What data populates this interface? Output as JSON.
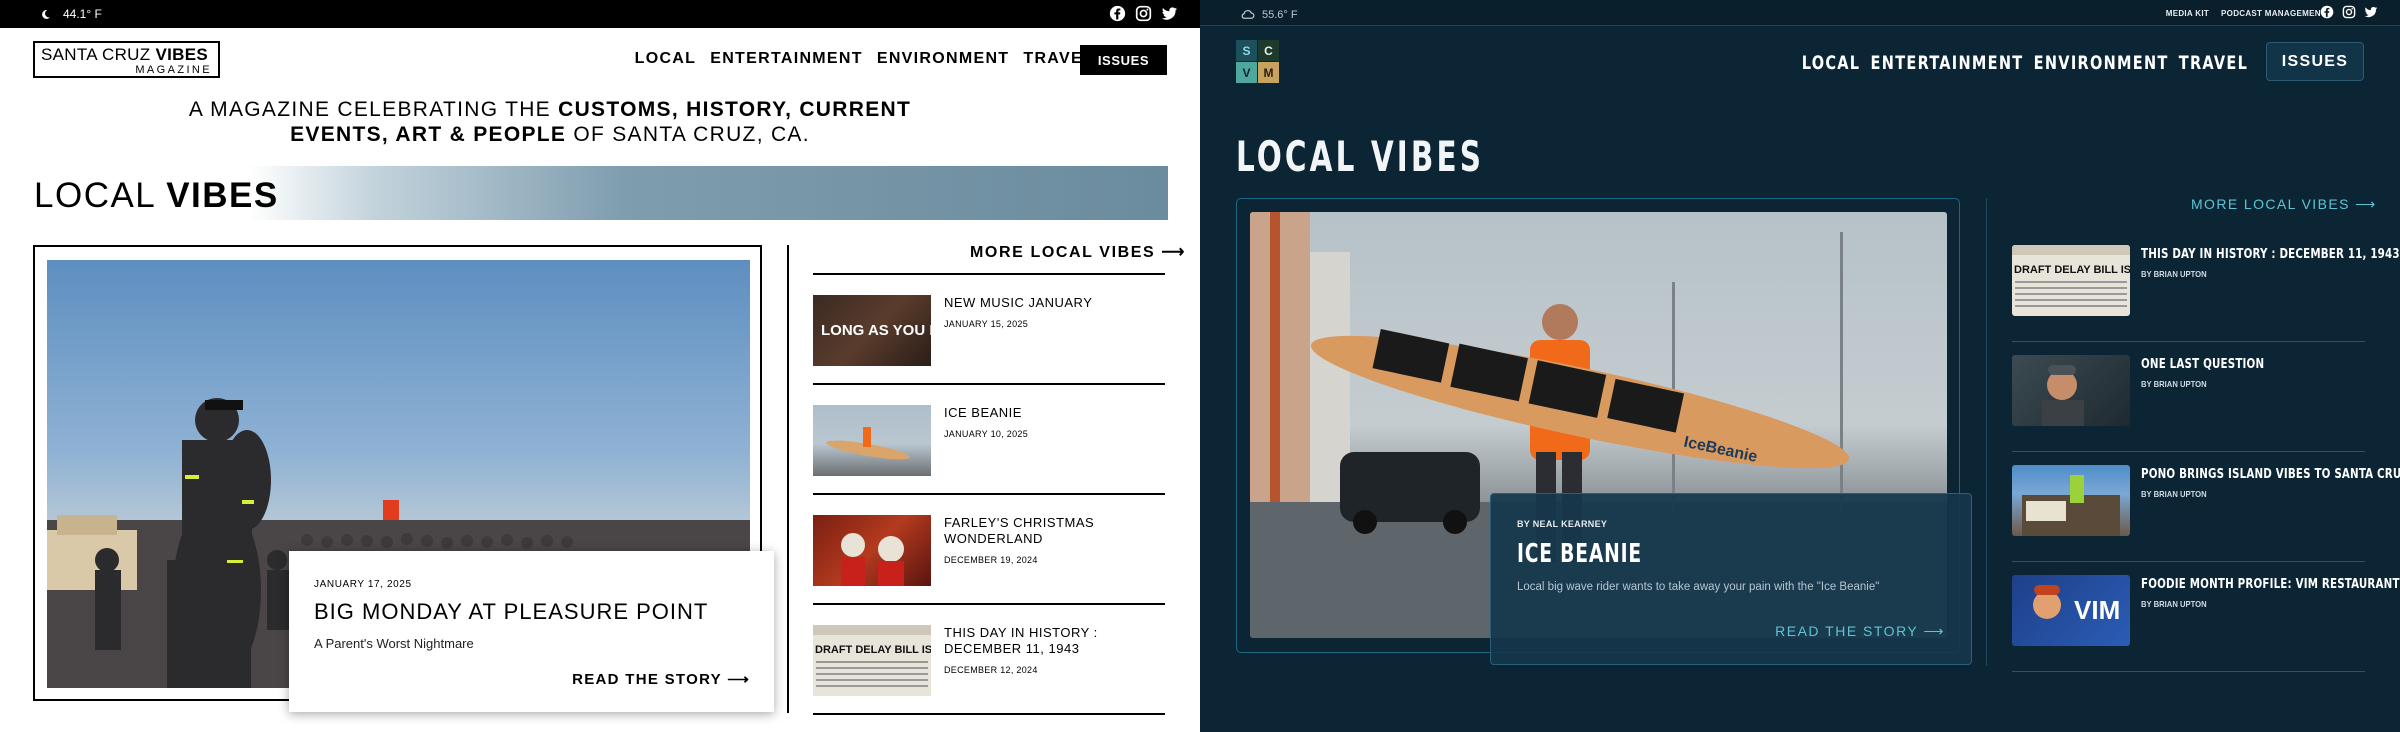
{
  "left": {
    "topbar": {
      "weather_icon": "moon-icon",
      "temperature": "44.1° F",
      "socials": [
        "facebook-icon",
        "instagram-icon",
        "twitter-icon"
      ]
    },
    "logo": {
      "line1_regular": "SANTA CRUZ ",
      "line1_bold": "VIBES",
      "line2": "MAGAZINE"
    },
    "nav": [
      "LOCAL",
      "ENTERTAINMENT",
      "ENVIRONMENT",
      "TRAVEL"
    ],
    "issues_label": "ISSUES",
    "tagline": {
      "p1": "A MAGAZINE CELEBRATING THE ",
      "b1": "CUSTOMS, HISTORY, CURRENT EVENTS, ART & PEOPLE",
      "p2": " OF SANTA CRUZ, CA."
    },
    "section": {
      "title_light": "LOCAL ",
      "title_bold": "VIBES"
    },
    "feature": {
      "date": "JANUARY 17, 2025",
      "headline": "BIG MONDAY AT PLEASURE POINT",
      "subtitle": "A Parent's Worst Nightmare",
      "cta": "READ THE STORY"
    },
    "more_label": "MORE LOCAL VIBES",
    "items": [
      {
        "title": "NEW MUSIC JANUARY",
        "date": "JANUARY 15, 2025",
        "thumb_text": "LONG AS YOU LIKE"
      },
      {
        "title": "ICE BEANIE",
        "date": "JANUARY 10, 2025"
      },
      {
        "title": "FARLEY'S CHRISTMAS WONDERLAND",
        "date": "DECEMBER 19, 2024"
      },
      {
        "title": "THIS DAY IN HISTORY : DECEMBER 11, 1943",
        "date": "DECEMBER 12, 2024",
        "thumb_text": "DRAFT DELAY BILL IS SI"
      }
    ],
    "colors": {
      "band": "#6b8c9e",
      "text": "#000000"
    }
  },
  "right": {
    "topbar": {
      "weather_icon": "cloud-icon",
      "temperature": "55.6° F",
      "links": [
        "MEDIA KIT",
        "PODCAST MANAGEMENT"
      ],
      "socials": [
        "facebook-icon",
        "instagram-icon",
        "twitter-icon"
      ]
    },
    "logo": {
      "letters": [
        "S",
        "C",
        "V",
        "M"
      ]
    },
    "nav": [
      "LOCAL",
      "ENTERTAINMENT",
      "ENVIRONMENT",
      "TRAVEL"
    ],
    "issues_label": "ISSUES",
    "section_title": "LOCAL VIBES",
    "feature": {
      "byline": "BY NEAL KEARNEY",
      "headline": "ICE BEANIE",
      "subtitle": "Local big wave rider wants to take away your pain with the \"Ice Beanie\"",
      "cta": "READ THE STORY",
      "board_text": "IceBeanie"
    },
    "more_label": "MORE LOCAL VIBES",
    "items": [
      {
        "title": "THIS DAY IN HISTORY : DECEMBER 11, 1943",
        "byline": "BY BRIAN UPTON",
        "thumb_text": "DRAFT DELAY BILL IS SI"
      },
      {
        "title": "ONE LAST QUESTION",
        "byline": "BY BRIAN UPTON"
      },
      {
        "title": "PONO BRINGS ISLAND VIBES TO SANTA CRUZ",
        "byline": "BY BRIAN UPTON"
      },
      {
        "title": "FOODIE MONTH PROFILE: VIM RESTAURANT",
        "byline": "BY BRIAN UPTON",
        "thumb_text": "VIM"
      }
    ],
    "colors": {
      "background": "#0c2535",
      "accent": "#5ec4d3",
      "logo_s": "#1e4f5c",
      "logo_c": "#1d3a2c",
      "logo_v": "#4ea8a0",
      "logo_m": "#c9a25e"
    }
  }
}
